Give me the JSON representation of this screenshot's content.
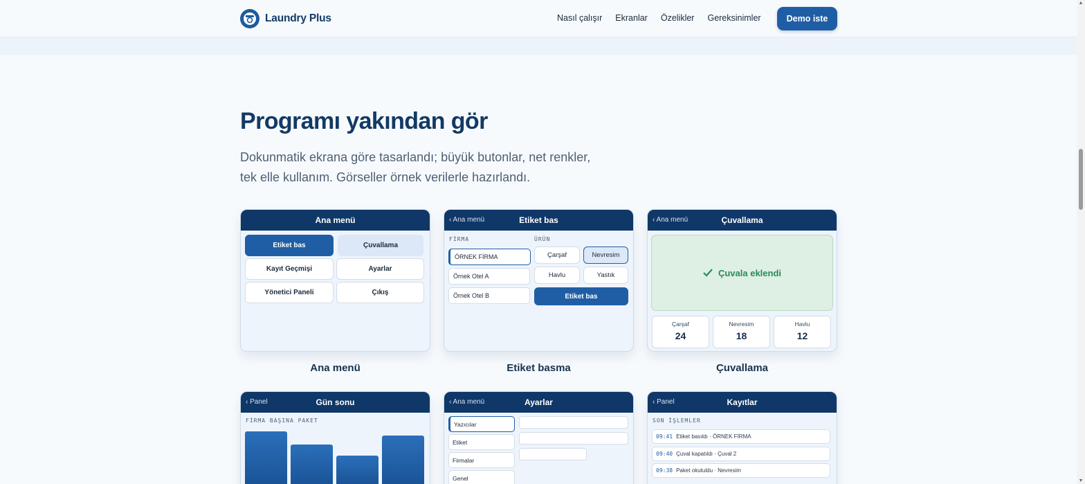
{
  "header": {
    "brand": "Laundry Plus",
    "nav": [
      "Nasıl çalışır",
      "Ekranlar",
      "Özelikler",
      "Gereksinimler"
    ],
    "cta": "Demo iste"
  },
  "section": {
    "title": "Programı yakından gör",
    "subtitle_line1": "Dokunmatik ekrana göre tasarlandı; büyük butonlar, net renkler,",
    "subtitle_line2": "tek elle kullanım. Görseller örnek verilerle hazırlandı."
  },
  "cards": {
    "main_menu": {
      "title": "Ana menü",
      "buttons": [
        "Etiket bas",
        "Çuvallama",
        "Kayıt Geçmişi",
        "Ayarlar",
        "Yönetici Paneli",
        "Çıkış"
      ],
      "caption": "Ana menü"
    },
    "label": {
      "back": "‹ Ana menü",
      "title": "Etiket bas",
      "firm_header": "FİRMA",
      "product_header": "ÜRÜN",
      "firms": [
        "ÖRNEK FİRMA",
        "Örnek Otel A",
        "Örnek Otel B"
      ],
      "products": [
        "Çarşaf",
        "Nevresim",
        "Havlu",
        "Yastık"
      ],
      "action": "Etiket bas",
      "caption": "Etiket basma"
    },
    "sack": {
      "back": "‹ Ana menü",
      "title": "Çuvallama",
      "status": "Çuvala eklendi",
      "counts": [
        {
          "label": "Çarşaf",
          "value": "24"
        },
        {
          "label": "Nevresim",
          "value": "18"
        },
        {
          "label": "Havlu",
          "value": "12"
        }
      ],
      "caption": "Çuvallama"
    },
    "day_end": {
      "back": "‹ Panel",
      "title": "Gün sonu",
      "chart_header": "FİRMA BAŞINA PAKET"
    },
    "settings": {
      "back": "‹ Ana menü",
      "title": "Ayarlar",
      "items": [
        "Yazıcılar",
        "Etiket",
        "Firmalar",
        "Genel"
      ]
    },
    "records": {
      "back": "‹ Panel",
      "title": "Kayıtlar",
      "list_header": "SON İŞLEMLER",
      "logs": [
        {
          "time": "09:41",
          "text": "Etiket basıldı · ÖRNEK FİRMA"
        },
        {
          "time": "09:40",
          "text": "Çuval kapatıldı · Çuval 2"
        },
        {
          "time": "09:38",
          "text": "Paket okutuldu · Nevresim"
        }
      ]
    }
  },
  "chart_data": {
    "type": "bar",
    "title": "FİRMA BAŞINA PAKET",
    "categories": [
      "",
      "",
      "",
      ""
    ],
    "values": [
      0.95,
      0.72,
      0.52,
      0.88
    ]
  },
  "colors": {
    "brand": "#1f5ea4",
    "navy": "#0f3767",
    "success": "#2a8a57"
  }
}
